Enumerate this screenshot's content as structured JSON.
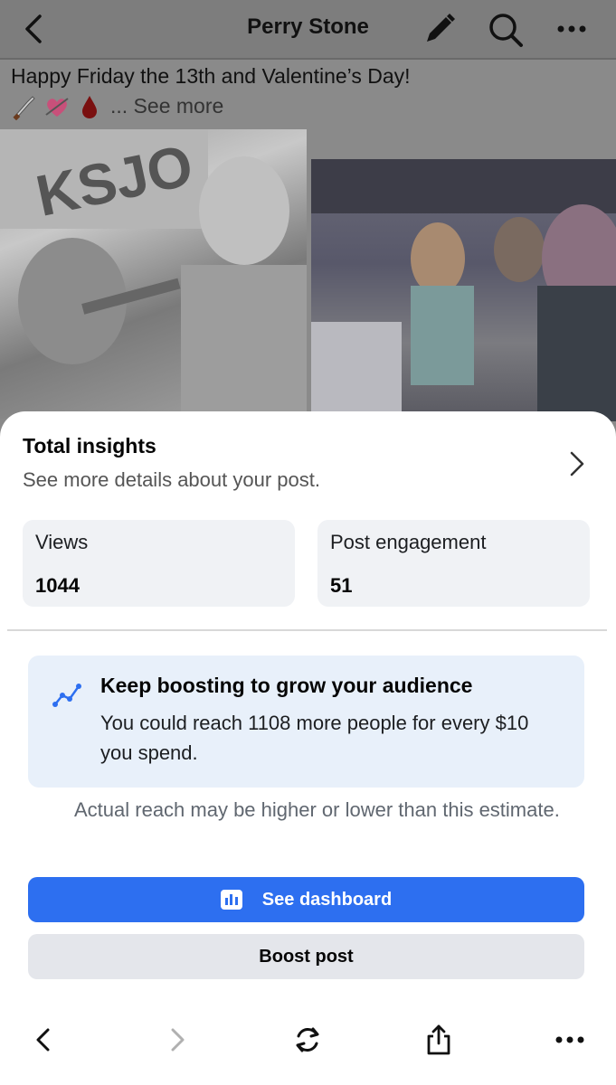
{
  "header": {
    "title": "Perry Stone",
    "icons": [
      "back-icon",
      "pencil-icon",
      "search-icon",
      "more-icon"
    ]
  },
  "post": {
    "text": "Happy Friday the 13th and Valentine’s Day!",
    "emojis": [
      "knife",
      "heart-with-arrow",
      "blood-drop"
    ],
    "see_more": "... See more",
    "images": [
      "photo-left-ksjo",
      "photo-right-restroom"
    ]
  },
  "insights": {
    "title": "Total insights",
    "subtitle": "See more details about your post.",
    "views_label": "Views",
    "views_value": "1044",
    "engagement_label": "Post engagement",
    "engagement_value": "51"
  },
  "boost_card": {
    "title": "Keep boosting to grow your audience",
    "body": "You could reach 1108 more people for every $10 you spend.",
    "note": "Actual reach may be higher or lower than this estimate."
  },
  "buttons": {
    "dashboard_label": "See dashboard",
    "boost_label": "Boost post"
  },
  "colors": {
    "primary_blue": "#2d6ff0",
    "card_bg": "#f0f2f5",
    "boost_card_bg": "#e8f0fa",
    "secondary_button": "#e4e6eb",
    "overlay_gray": "#8a8a8a"
  },
  "toolbar": {
    "icons": [
      "back-arrow-icon",
      "forward-arrow-icon",
      "reload-icon",
      "share-icon",
      "more-icon"
    ]
  }
}
